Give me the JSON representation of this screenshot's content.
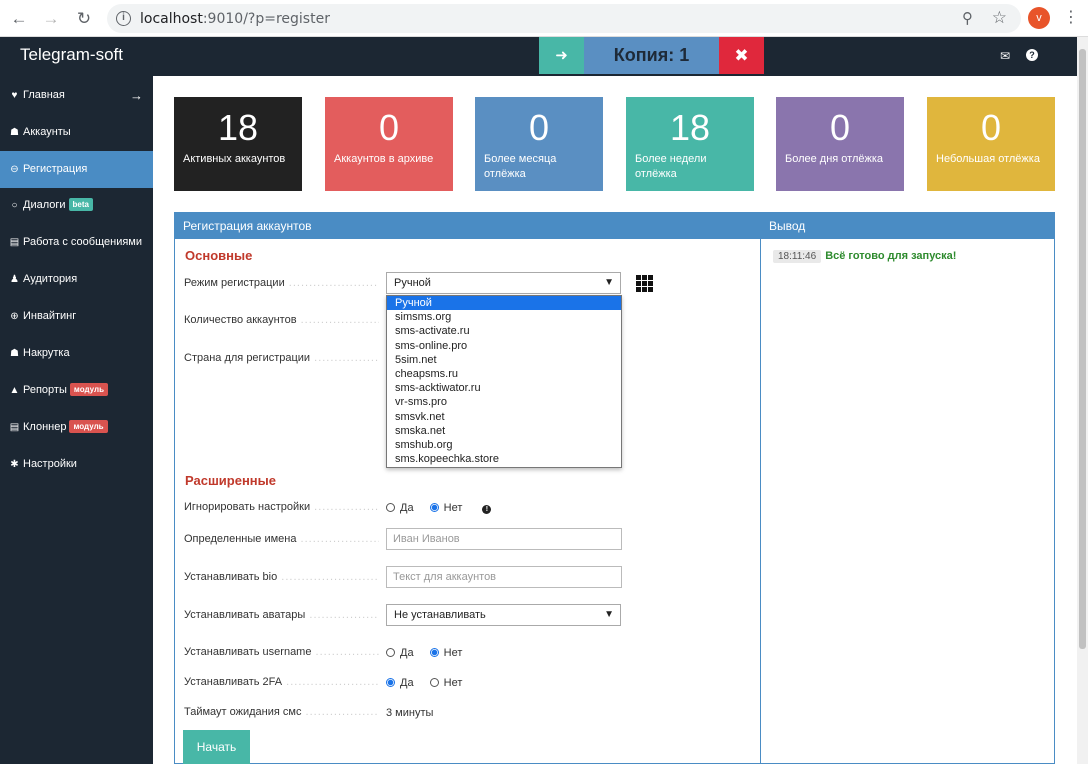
{
  "browser": {
    "url_host": "localhost",
    "url_rest": ":9010/?p=register",
    "profile_initial": "v"
  },
  "header": {
    "brand": "Telegram-soft",
    "copy_title": "Копия: 1"
  },
  "sidebar": {
    "items": [
      {
        "label": "Главная",
        "icon": "heart-icon"
      },
      {
        "label": "Аккаунты",
        "icon": "users-icon"
      },
      {
        "label": "Регистрация",
        "icon": "plus-circle-icon",
        "active": true
      },
      {
        "label": "Диалоги",
        "icon": "chat-icon",
        "tag": "beta"
      },
      {
        "label": "Работа с сообщениями",
        "icon": "list-icon"
      },
      {
        "label": "Аудитория",
        "icon": "audience-icon"
      },
      {
        "label": "Инвайтинг",
        "icon": "plus-icon"
      },
      {
        "label": "Накрутка",
        "icon": "users-icon"
      },
      {
        "label": "Репорты",
        "icon": "warning-icon",
        "tag": "модуль"
      },
      {
        "label": "Клоннер",
        "icon": "list-icon",
        "tag": "модуль"
      },
      {
        "label": "Настройки",
        "icon": "gear-icon"
      }
    ]
  },
  "stats": [
    {
      "value": "18",
      "label": "Активных аккаунтов",
      "color": "#222222"
    },
    {
      "value": "0",
      "label": "Аккаунтов в архиве",
      "color": "#e35d5d"
    },
    {
      "value": "0",
      "label": "Более месяца отлёжка",
      "color": "#5a8fc2"
    },
    {
      "value": "18",
      "label": "Более недели отлёжка",
      "color": "#48b7a7"
    },
    {
      "value": "0",
      "label": "Более дня отлёжка",
      "color": "#8a75ad"
    },
    {
      "value": "0",
      "label": "Небольшая отлёжка",
      "color": "#e0b63d"
    }
  ],
  "register_panel": {
    "title": "Регистрация аккаунтов",
    "basic_title": "Основные",
    "advanced_title": "Расширенные",
    "fields": {
      "mode_label": "Режим регистрации",
      "mode_value": "Ручной",
      "count_label": "Количество аккаунтов",
      "country_label": "Страна для регистрации",
      "ignore_label": "Игнорировать настройки",
      "names_label": "Определенные имена",
      "names_placeholder": "Иван Иванов",
      "bio_label": "Устанавливать bio",
      "bio_placeholder": "Текст для аккаунтов",
      "avatars_label": "Устанавливать аватары",
      "avatars_value": "Не устанавливать",
      "username_label": "Устанавливать username",
      "twofa_label": "Устанавливать 2FA",
      "timeout_label": "Таймаут ожидания смс",
      "timeout_value": "3 минуты"
    },
    "yes": "Да",
    "no": "Нет",
    "start_button": "Начать",
    "dropdown_options": [
      "Ручной",
      "simsms.org",
      "sms-activate.ru",
      "sms-online.pro",
      "5sim.net",
      "cheapsms.ru",
      "sms-acktiwator.ru",
      "vr-sms.pro",
      "smsvk.net",
      "smska.net",
      "smshub.org",
      "sms.kopeechka.store"
    ]
  },
  "output_panel": {
    "title": "Вывод",
    "log": [
      {
        "time": "18:11:46",
        "message": "Всё готово для запуска!"
      }
    ]
  }
}
